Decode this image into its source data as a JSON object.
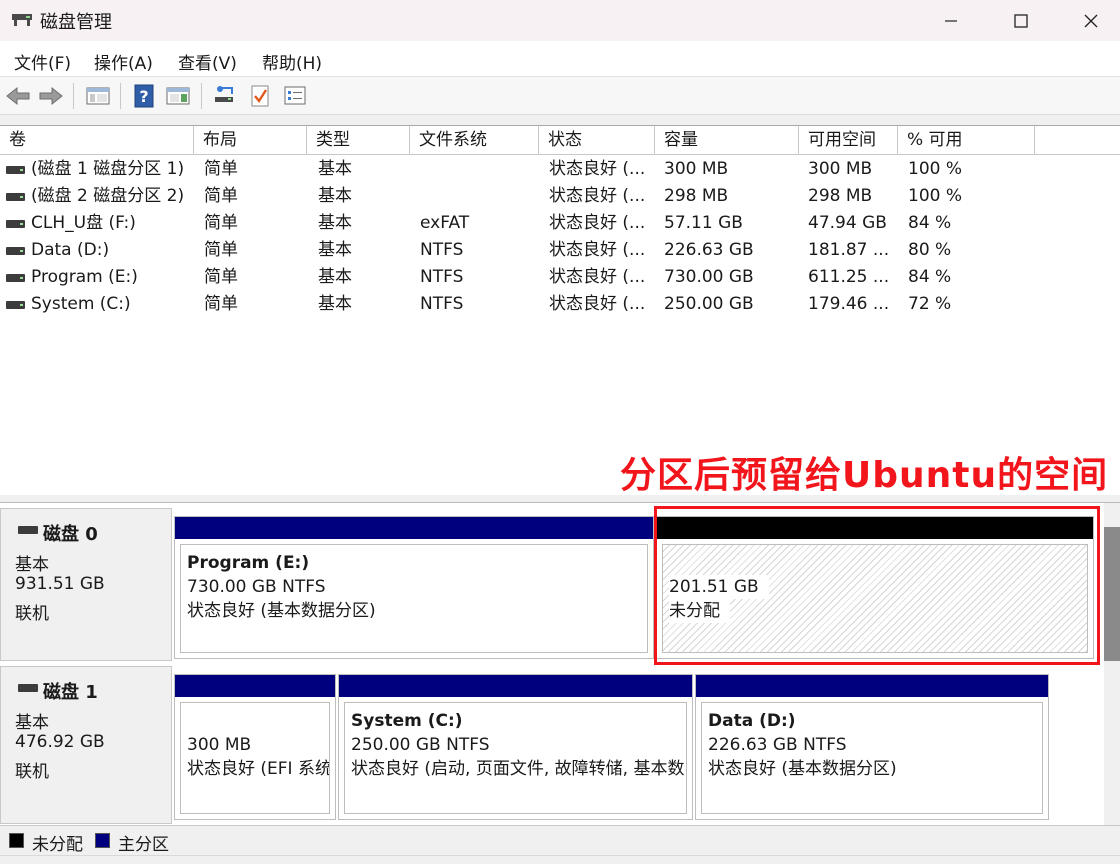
{
  "window": {
    "title": "磁盘管理"
  },
  "menu": [
    {
      "label": "文件(F)"
    },
    {
      "label": "操作(A)"
    },
    {
      "label": "查看(V)"
    },
    {
      "label": "帮助(H)"
    }
  ],
  "toolbar": {
    "icons": [
      "back-arrow-icon",
      "forward-arrow-icon",
      "show-hide-tree-icon",
      "help-icon",
      "show-hide-action-pane-icon",
      "connect-virtual-disk-icon",
      "check-icon",
      "properties-icon"
    ]
  },
  "volume_list": {
    "columns": [
      "卷",
      "布局",
      "类型",
      "文件系统",
      "状态",
      "容量",
      "可用空间",
      "% 可用"
    ],
    "rows": [
      {
        "volume": "(磁盘 1 磁盘分区 1)",
        "layout": "简单",
        "type": "基本",
        "fs": "",
        "status": "状态良好 (...",
        "capacity": "300 MB",
        "free": "300 MB",
        "pct": "100 %"
      },
      {
        "volume": "(磁盘 2 磁盘分区 2)",
        "layout": "简单",
        "type": "基本",
        "fs": "",
        "status": "状态良好 (...",
        "capacity": "298 MB",
        "free": "298 MB",
        "pct": "100 %"
      },
      {
        "volume": "CLH_U盘 (F:)",
        "layout": "简单",
        "type": "基本",
        "fs": "exFAT",
        "status": "状态良好 (...",
        "capacity": "57.11 GB",
        "free": "47.94 GB",
        "pct": "84 %"
      },
      {
        "volume": "Data (D:)",
        "layout": "简单",
        "type": "基本",
        "fs": "NTFS",
        "status": "状态良好 (...",
        "capacity": "226.63 GB",
        "free": "181.87 ...",
        "pct": "80 %"
      },
      {
        "volume": "Program (E:)",
        "layout": "简单",
        "type": "基本",
        "fs": "NTFS",
        "status": "状态良好 (...",
        "capacity": "730.00 GB",
        "free": "611.25 ...",
        "pct": "84 %"
      },
      {
        "volume": "System (C:)",
        "layout": "简单",
        "type": "基本",
        "fs": "NTFS",
        "status": "状态良好 (...",
        "capacity": "250.00 GB",
        "free": "179.46 ...",
        "pct": "72 %"
      }
    ]
  },
  "annotation": {
    "text": "分区后预留给Ubuntu的空间",
    "color": "#f2161c"
  },
  "disks": [
    {
      "name": "磁盘 0",
      "type": "基本",
      "size": "931.51 GB",
      "state": "联机",
      "partitions": [
        {
          "name": "Program  (E:)",
          "size": "730.00 GB NTFS",
          "status": "状态良好 (基本数据分区)"
        },
        {
          "name": "",
          "size": "201.51 GB",
          "status": "未分配"
        }
      ]
    },
    {
      "name": "磁盘 1",
      "type": "基本",
      "size": "476.92 GB",
      "state": "联机",
      "partitions": [
        {
          "name": "",
          "size": "300 MB",
          "status": "状态良好 (EFI 系统"
        },
        {
          "name": "System  (C:)",
          "size": "250.00 GB NTFS",
          "status": "状态良好 (启动, 页面文件, 故障转储, 基本数"
        },
        {
          "name": "Data  (D:)",
          "size": "226.63 GB NTFS",
          "status": "状态良好 (基本数据分区)"
        }
      ]
    }
  ],
  "legend": [
    {
      "label": "未分配",
      "color": "#000000"
    },
    {
      "label": "主分区",
      "color": "#00007f"
    }
  ]
}
